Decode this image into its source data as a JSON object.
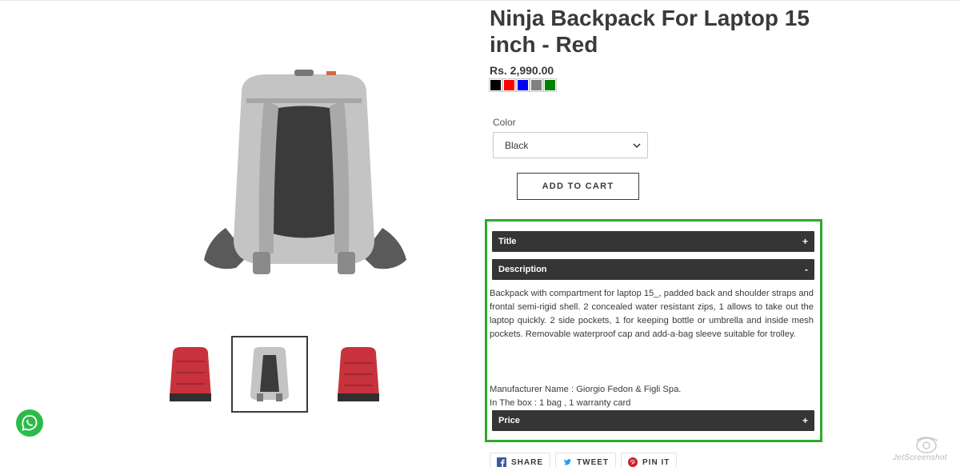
{
  "product": {
    "title": "Ninja Backpack For Laptop 15 inch - Red",
    "price": "Rs. 2,990.00",
    "swatches": [
      "#000000",
      "#ff0000",
      "#0000ff",
      "#808080",
      "#008000"
    ],
    "color_label": "Color",
    "color_selected": "Black",
    "add_to_cart": "ADD TO CART",
    "accordion": {
      "title_label": "Title",
      "title_sign": "+",
      "description_label": "Description",
      "description_sign": "-",
      "description_text": "Backpack with compartment for laptop 15_, padded back and shoulder straps and frontal semi-rigid shell. 2 concealed water resistant zips, 1 allows to take out the laptop quickly. 2 side pockets, 1 for keeping bottle or umbrella and inside mesh pockets. Removable waterproof cap and add-a-bag sleeve suitable for trolley.",
      "manufacturer": "Manufacturer Name : Giorgio Fedon & Figli Spa.",
      "in_the_box": "In The box : 1 bag , 1 warranty card",
      "price_label": "Price",
      "price_sign": "+"
    },
    "share": {
      "facebook": "SHARE",
      "twitter": "TWEET",
      "pinterest": "PIN IT"
    },
    "accent_color": "#2daa2d",
    "header_bg": "#353535"
  },
  "watermark": {
    "text": "JetScreenshot"
  }
}
